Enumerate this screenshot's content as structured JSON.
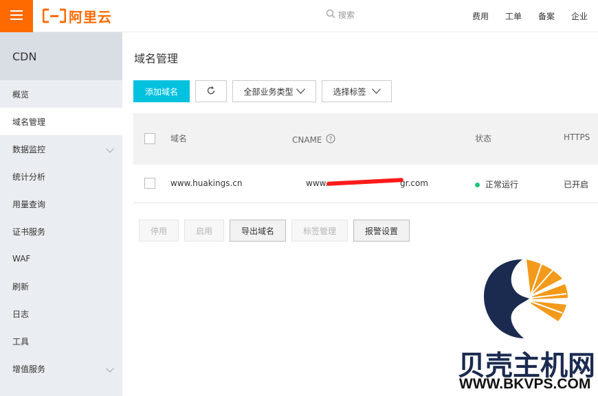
{
  "header": {
    "logo_text": "阿里云",
    "search_placeholder": "搜索",
    "nav": [
      "费用",
      "工单",
      "备案",
      "企业"
    ],
    "brand_color": "#ff6a00"
  },
  "sidebar": {
    "title": "CDN",
    "items": [
      {
        "label": "概览",
        "active": false,
        "expandable": false
      },
      {
        "label": "域名管理",
        "active": true,
        "expandable": false
      },
      {
        "label": "数据监控",
        "active": false,
        "expandable": true
      },
      {
        "label": "统计分析",
        "active": false,
        "expandable": false
      },
      {
        "label": "用量查询",
        "active": false,
        "expandable": false
      },
      {
        "label": "证书服务",
        "active": false,
        "expandable": false
      },
      {
        "label": "WAF",
        "active": false,
        "expandable": false
      },
      {
        "label": "刷新",
        "active": false,
        "expandable": false
      },
      {
        "label": "日志",
        "active": false,
        "expandable": false
      },
      {
        "label": "工具",
        "active": false,
        "expandable": false
      },
      {
        "label": "增值服务",
        "active": false,
        "expandable": true
      }
    ]
  },
  "main": {
    "title": "域名管理",
    "toolbar": {
      "add_domain": "添加域名",
      "refresh_icon": "refresh-icon",
      "business_type": "全部业务类型",
      "select_tag": "选择标签"
    },
    "table": {
      "headers": {
        "domain": "域名",
        "cname": "CNAME",
        "status": "状态",
        "https": "HTTPS"
      },
      "rows": [
        {
          "domain": "www.huakings.cn",
          "cname_prefix": "www.",
          "cname_suffix": "gr.com",
          "status": "正常运行",
          "https": "已开启"
        }
      ]
    },
    "bulk_actions": {
      "stop": "停用",
      "start": "启用",
      "export": "导出域名",
      "tag_manage": "标签管理",
      "alarm": "报警设置"
    }
  },
  "watermark": {
    "cn": "贝壳主机网",
    "en": "WWW.BKVPS.COM"
  },
  "colors": {
    "accent": "#00c1de",
    "status_ok": "#1ec47a",
    "sidebar_bg": "#eaedf1"
  }
}
